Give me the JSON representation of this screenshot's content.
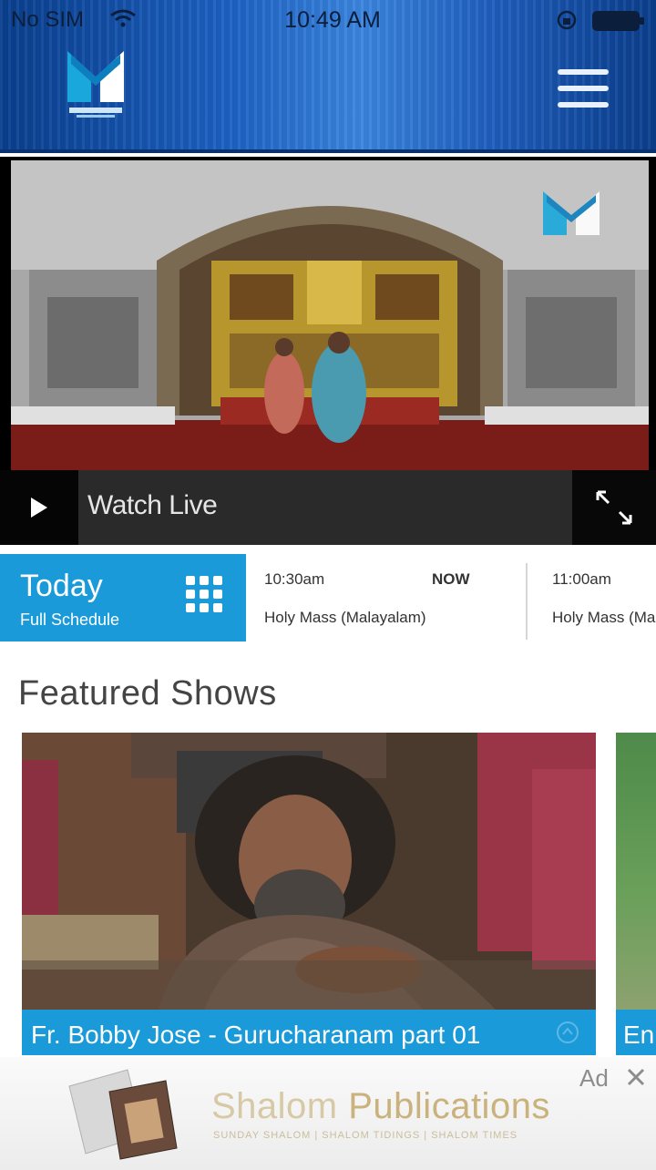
{
  "status_bar": {
    "carrier": "No SIM",
    "time": "10:49 AM"
  },
  "header": {
    "menu_icon": "hamburger-icon",
    "logo_icon": "shalom-logo"
  },
  "player": {
    "watch_live_label": "Watch Live",
    "play_icon": "play-icon",
    "fullscreen_icon": "fullscreen-icon"
  },
  "schedule": {
    "today_label": "Today",
    "full_schedule_label": "Full Schedule",
    "grid_icon": "grid-icon",
    "slots": [
      {
        "time": "10:30am",
        "status": "NOW",
        "title": "Holy Mass (Malayalam)"
      },
      {
        "time": "11:00am",
        "title": "Holy Mass (Malayalam)"
      }
    ]
  },
  "featured": {
    "section_title": "Featured Shows",
    "cards": [
      {
        "title": "Fr. Bobby Jose - Gurucharanam part 01"
      },
      {
        "title": "En"
      }
    ]
  },
  "ad": {
    "brand_part1": "Shalom ",
    "brand_part2": "Publications",
    "tagline": "SUNDAY SHALOM | SHALOM TIDINGS | SHALOM TIMES",
    "ad_label": "Ad",
    "close_icon": "close-icon"
  },
  "colors": {
    "accent_blue": "#1a9ad8",
    "header_blue": "#1d62c4"
  }
}
